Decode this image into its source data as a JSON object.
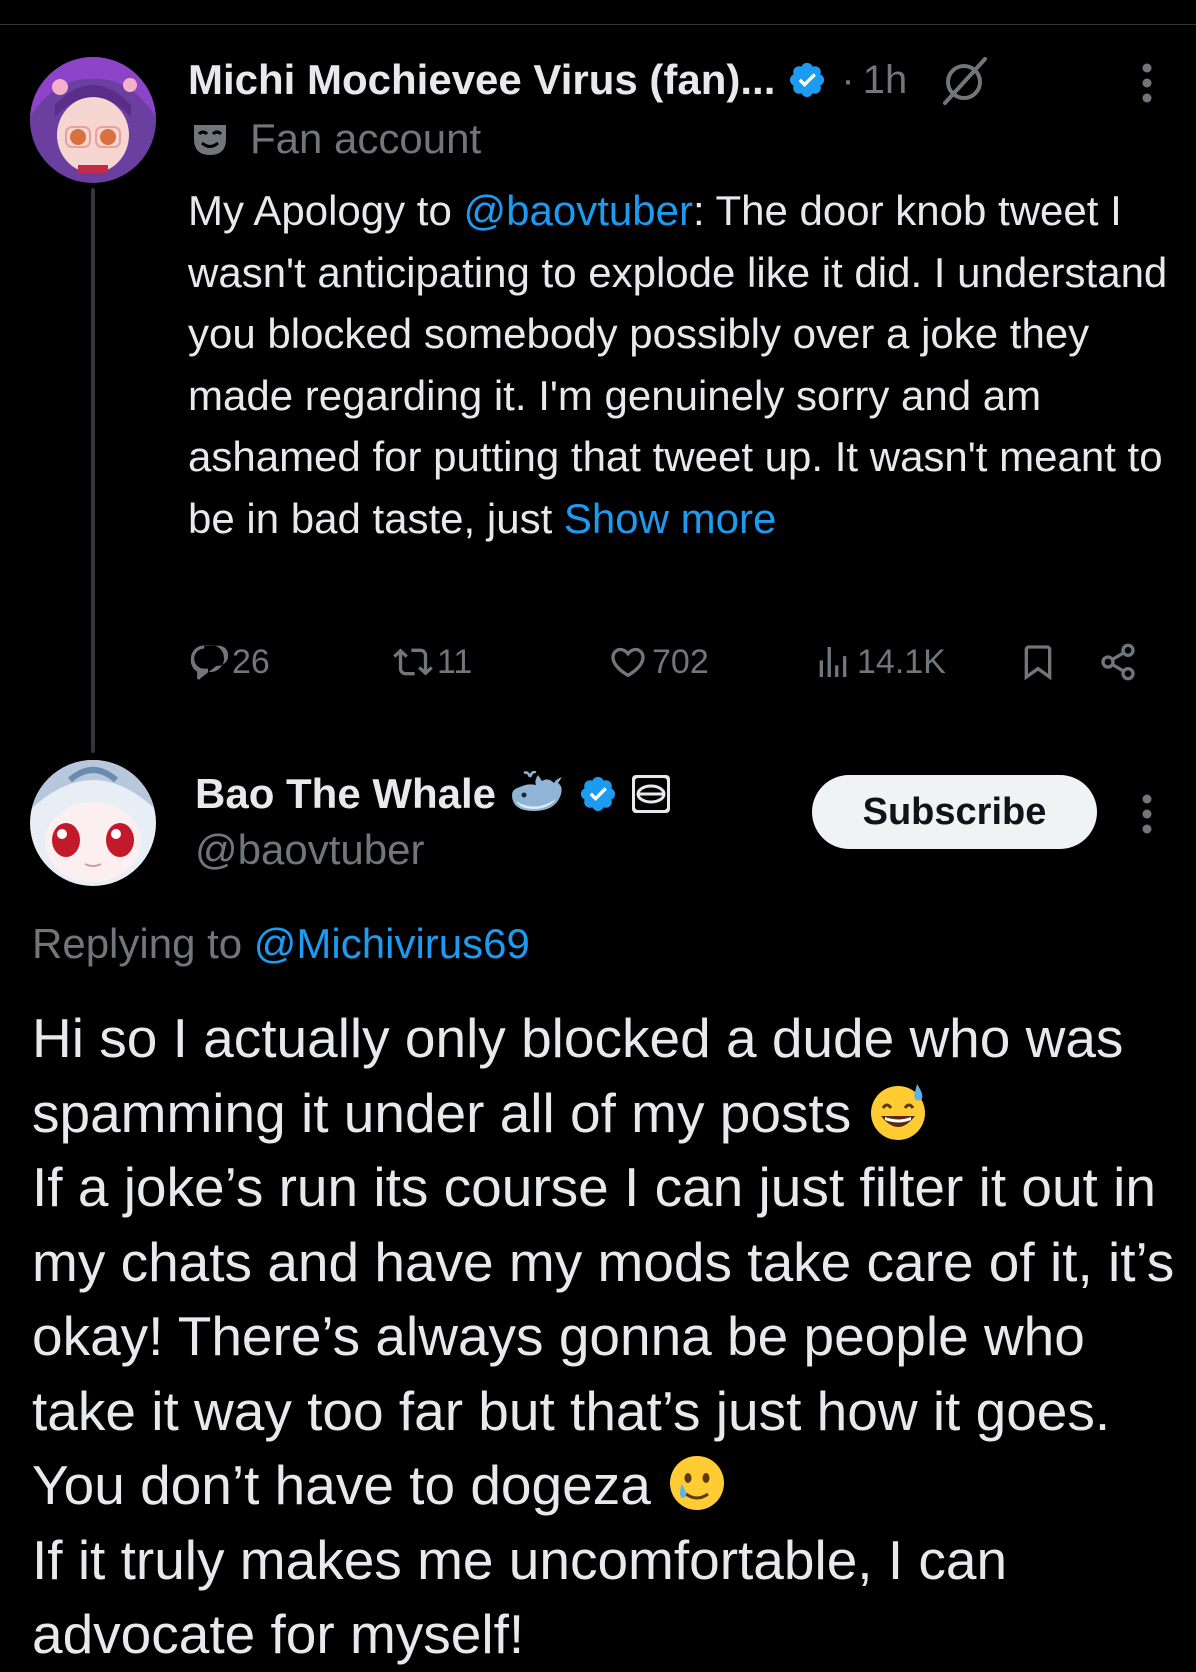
{
  "tweet": {
    "display_name": "Michi Mochievee Virus (fan)...",
    "dot": "·",
    "time": "1h",
    "subtitle_label": "Fan account",
    "body_pre": "My Apology to ",
    "body_mention": "@baovtuber",
    "body_post": ": The door knob tweet I wasn't anticipating to explode like it did. I understand you blocked somebody possibly over a joke they made regarding it. I'm genuinely sorry and am ashamed for putting that tweet up. It wasn't meant to be in bad taste, just ",
    "show_more": "Show more",
    "stats": {
      "replies": "26",
      "reposts": "11",
      "likes": "702",
      "views": "14.1K"
    }
  },
  "reply": {
    "display_name": "Bao The Whale",
    "handle": "@baovtuber",
    "subscribe_label": "Subscribe",
    "replying_prefix": "Replying to ",
    "replying_mention": "@Michivirus69",
    "lines": {
      "l1": "Hi so I actually only blocked a dude who was spamming it under all of my posts ",
      "l2": "If a joke’s run its course I can just filter it out in my chats and have my mods take care of it, it’s okay! There’s always gonna be people who take it way too far but that’s just how it goes. You don’t have to dogeza ",
      "l3": "If it truly makes me uncomfortable, I can advocate for myself!"
    }
  },
  "colors": {
    "background": "#000000",
    "text": "#e7e9ea",
    "muted": "#71767b",
    "link": "#1d9bf0",
    "verified": "#1d9bf0"
  },
  "icons": [
    "verified-badge-icon",
    "null-circle-icon",
    "more-icon",
    "mask-icon",
    "reply-icon",
    "repost-icon",
    "like-icon",
    "views-icon",
    "bookmark-icon",
    "share-icon",
    "whale-emoji-icon",
    "gov-badge-icon",
    "sweat-smile-emoji",
    "smile-tear-emoji"
  ]
}
